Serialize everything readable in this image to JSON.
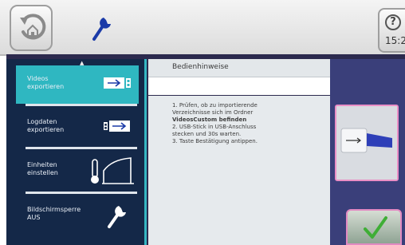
{
  "header": {
    "back_icon": "back-home-icon",
    "tool_icon": "wrench-icon",
    "help_label": "?",
    "clock": "15:2"
  },
  "sidebar": {
    "items": [
      {
        "label_line1": "Videos",
        "label_line2": "exportieren",
        "icon": "usb-export-icon",
        "active": true
      },
      {
        "label_line1": "Logdaten",
        "label_line2": "exportieren",
        "icon": "usb-export-icon",
        "active": false
      },
      {
        "label_line1": "Einheiten",
        "label_line2": "einstellen",
        "icon": "thermometer-curve-icon",
        "active": false
      },
      {
        "label_line1": "Bildschirmsperre",
        "label_line2": "AUS",
        "icon": "wrench-icon",
        "active": false
      }
    ]
  },
  "panel": {
    "title": "Bedienhinweise",
    "lines": [
      "1. Prüfen, ob zu importierende",
      "Verzeichnisse sich im Ordner",
      "VideosCustom befinden",
      "2. USB-Stick in USB-Anschluss",
      "stecken und 30s warten.",
      "3. Taste Bestätigung antippen."
    ]
  },
  "right": {
    "usb_image_icon": "usb-stick-image",
    "confirm_icon": "checkmark-icon"
  },
  "colors": {
    "active_item": "#2fb7c1",
    "sidebar_bg": "#142848",
    "accent_border": "#ea8fc6",
    "confirm_check": "#3fae36"
  }
}
